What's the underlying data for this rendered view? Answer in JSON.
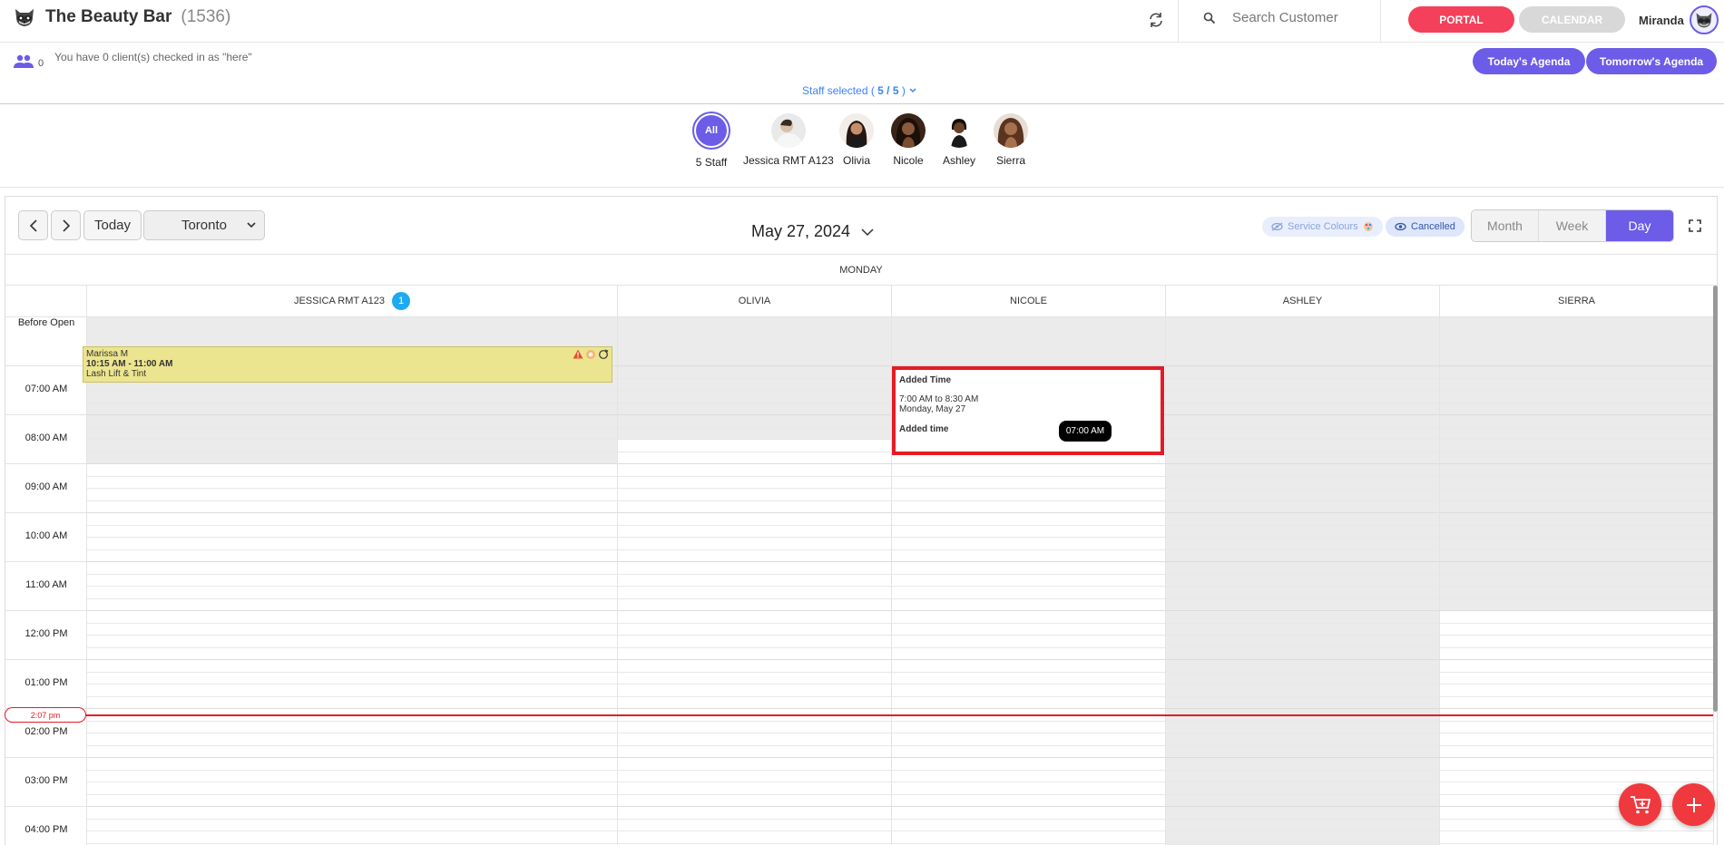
{
  "brand": {
    "name": "The Beauty Bar",
    "count": "(1536)"
  },
  "search": {
    "placeholder": "Search Customer"
  },
  "header_buttons": {
    "portal": "PORTAL",
    "calendar": "CALENDAR"
  },
  "user": {
    "name": "Miranda"
  },
  "checkin": {
    "count": "0",
    "message": "You have 0 client(s) checked in as \"here\""
  },
  "agenda": {
    "today": "Today's Agenda",
    "tomorrow": "Tomorrow's Agenda"
  },
  "staff_selected": {
    "prefix": "Staff selected ( ",
    "value": "5 / 5",
    "suffix": " )"
  },
  "staff_filter": [
    {
      "label": "5 Staff",
      "badge": "All"
    },
    {
      "label": "Jessica RMT A123"
    },
    {
      "label": "Olivia"
    },
    {
      "label": "Nicole"
    },
    {
      "label": "Ashley"
    },
    {
      "label": "Sierra"
    }
  ],
  "toolbar": {
    "today": "Today",
    "timezone": "Toronto",
    "date": "May 27, 2024",
    "service_colours": "Service Colours",
    "cancelled": "Cancelled",
    "views": [
      "Month",
      "Week",
      "Day"
    ],
    "active_view": "Day"
  },
  "day_name": "MONDAY",
  "columns": [
    {
      "name": "JESSICA RMT A123",
      "badge": "1"
    },
    {
      "name": "OLIVIA"
    },
    {
      "name": "NICOLE"
    },
    {
      "name": "ASHLEY"
    },
    {
      "name": "SIERRA"
    }
  ],
  "time_labels": [
    "Before Open",
    "07:00 AM",
    "08:00 AM",
    "09:00 AM",
    "10:00 AM",
    "11:00 AM",
    "12:00 PM",
    "01:00 PM",
    "02:00 PM",
    "03:00 PM",
    "04:00 PM"
  ],
  "appointment": {
    "client": "Marissa M",
    "time": "10:15 AM - 11:00 AM",
    "service": "Lash Lift & Tint"
  },
  "popup": {
    "title": "Added Time",
    "range": "7:00 AM to 8:30 AM",
    "date": "Monday, May 27",
    "note": "Added time",
    "tooltip": "07:00 AM"
  },
  "now_indicator": "2:07 pm",
  "colors": {
    "accent": "#6c5ce7",
    "portal": "#f4405a",
    "now": "#e31c25",
    "appointment": "#ece58f",
    "badge": "#1eaaf1"
  }
}
